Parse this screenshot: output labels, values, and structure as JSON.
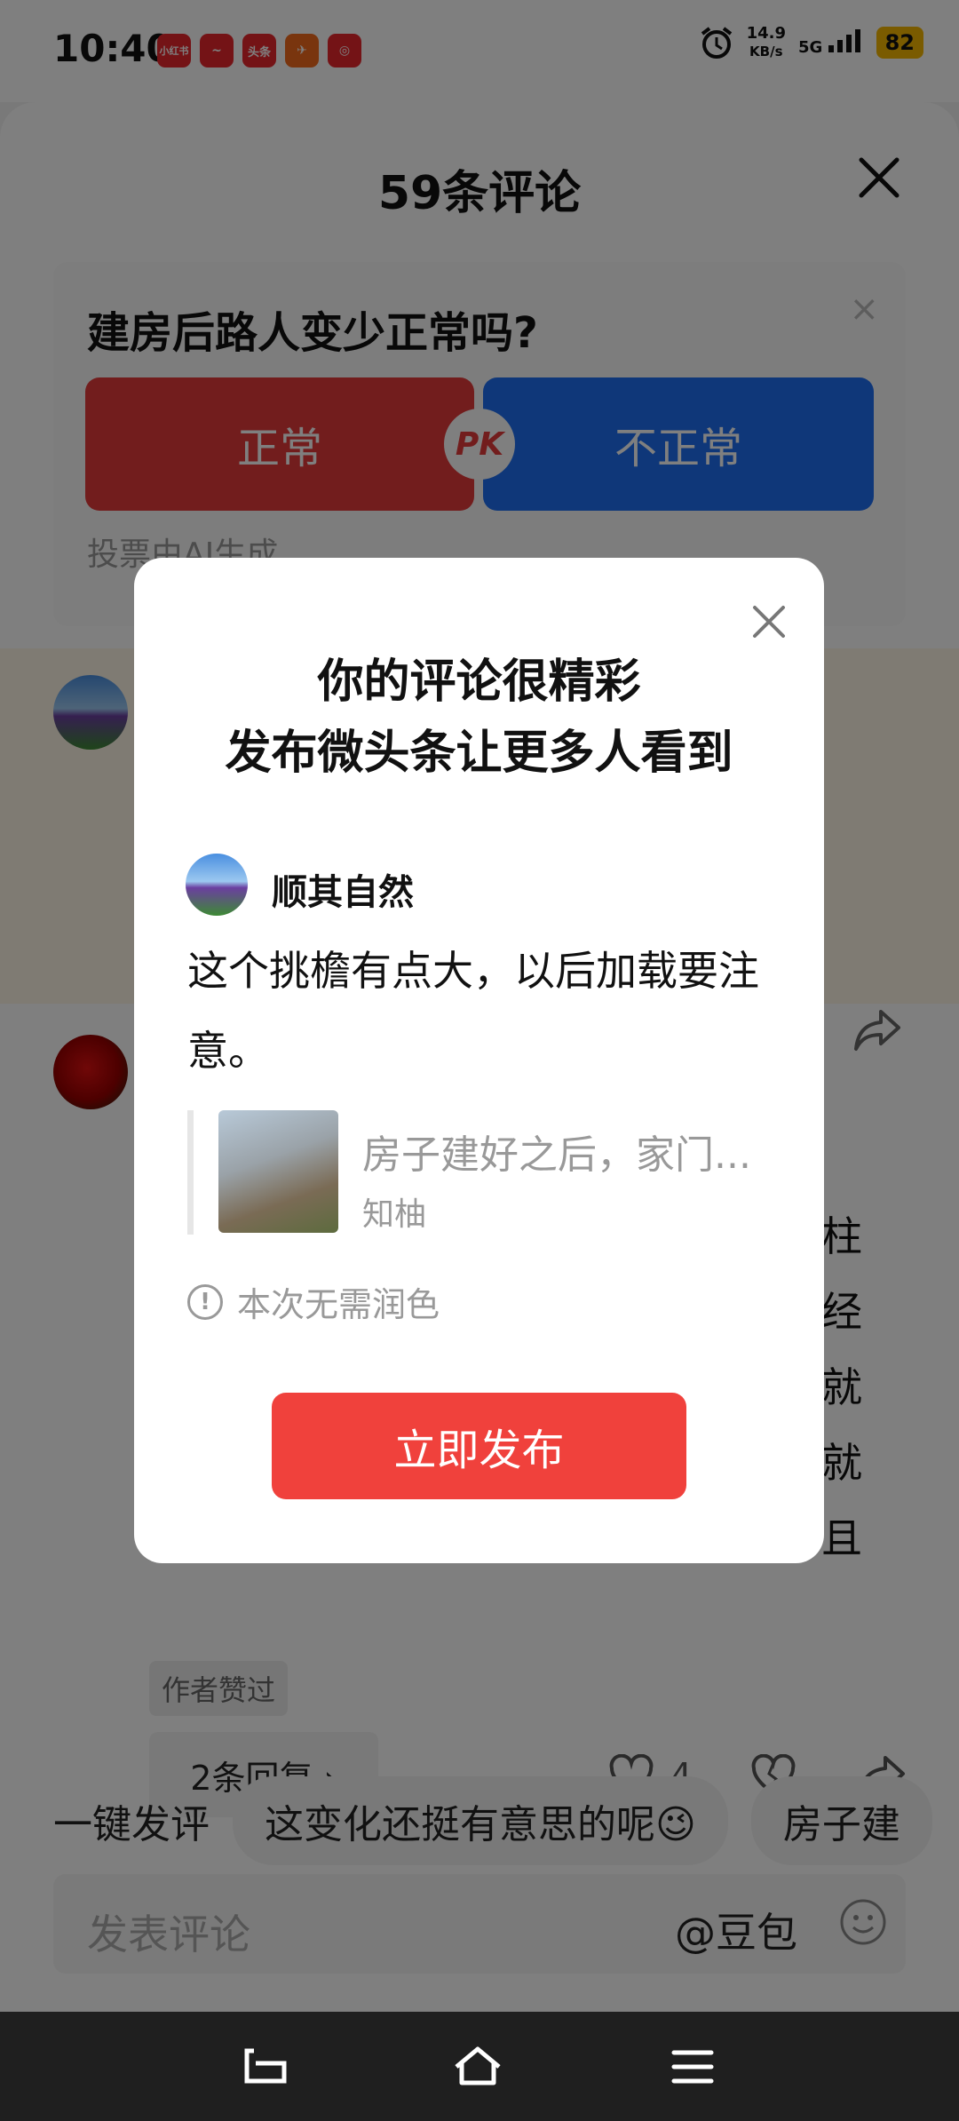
{
  "status": {
    "time": "10:40",
    "apps": [
      "小红书",
      "~",
      "头条",
      "✈",
      "◎"
    ],
    "net_speed_value": "14.9",
    "net_speed_unit": "KB/s",
    "network": "5G",
    "battery": "82"
  },
  "sheet": {
    "title": "59条评论"
  },
  "poll": {
    "question": "建房后路人变少正常吗?",
    "option_yes": "正常",
    "option_no": "不正常",
    "pk": "PK",
    "note": "投票由AI生成"
  },
  "comment": {
    "text_fragment": "柱\n经\n就\n就\n且",
    "liked_badge": "作者赞过",
    "replies": "2条回复 ›",
    "likes": "4"
  },
  "quick": {
    "label": "一键发评",
    "chip1": "这变化还挺有意思的呢😉",
    "chip2": "房子建"
  },
  "input": {
    "placeholder": "发表评论",
    "mention": "@豆包"
  },
  "modal": {
    "title_line1": "你的评论很精彩",
    "title_line2": "发布微头条让更多人看到",
    "author": "顺其自然",
    "comment": "这个挑檐有点大，以后加载要注意。",
    "quote_title": "房子建好之后，家门...",
    "quote_source": "知柚",
    "hint": "本次无需润色",
    "publish": "立即发布"
  },
  "colors": {
    "accent_red": "#f0413c",
    "poll_red": "#e53a3a",
    "poll_blue": "#1e6ef2",
    "battery": "#f5b700"
  }
}
